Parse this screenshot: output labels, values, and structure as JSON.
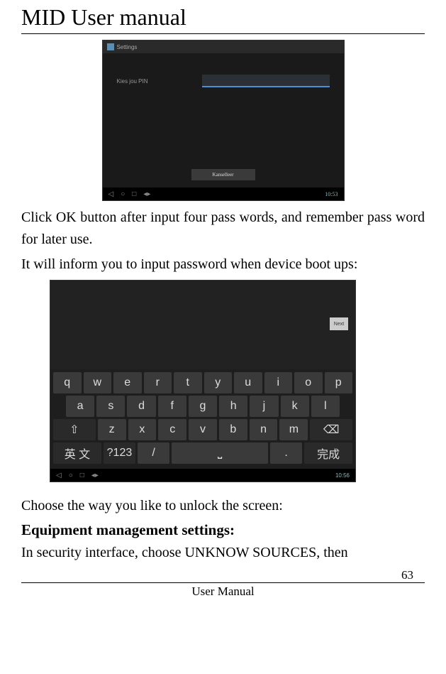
{
  "header": {
    "title": "MID User manual"
  },
  "screenshot1": {
    "app_title": "Settings",
    "pin_label": "Kies jou PIN",
    "cancel_label": "Kanselleer",
    "clock": "10:53"
  },
  "para1": "Click OK button after input four pass words, and remember pass word for later use.",
  "para2": "It will inform you to input password when device boot ups:",
  "screenshot2": {
    "next_label": "Next",
    "row1": [
      "q",
      "w",
      "e",
      "r",
      "t",
      "y",
      "u",
      "i",
      "o",
      "p"
    ],
    "row2": [
      "a",
      "s",
      "d",
      "f",
      "g",
      "h",
      "j",
      "k",
      "l"
    ],
    "row3": [
      "⇧",
      "z",
      "x",
      "c",
      "v",
      "b",
      "n",
      "m",
      "⌫"
    ],
    "row4": [
      "英 文",
      "?123",
      "/",
      "⎵",
      ".",
      "完成"
    ],
    "clock": "10:56"
  },
  "para3": "Choose the way you like to unlock the screen:",
  "heading": "Equipment management settings:",
  "para4": "In security interface, choose UNKNOW SOURCES, then",
  "footer": {
    "page_num": "63",
    "label": "User Manual"
  }
}
